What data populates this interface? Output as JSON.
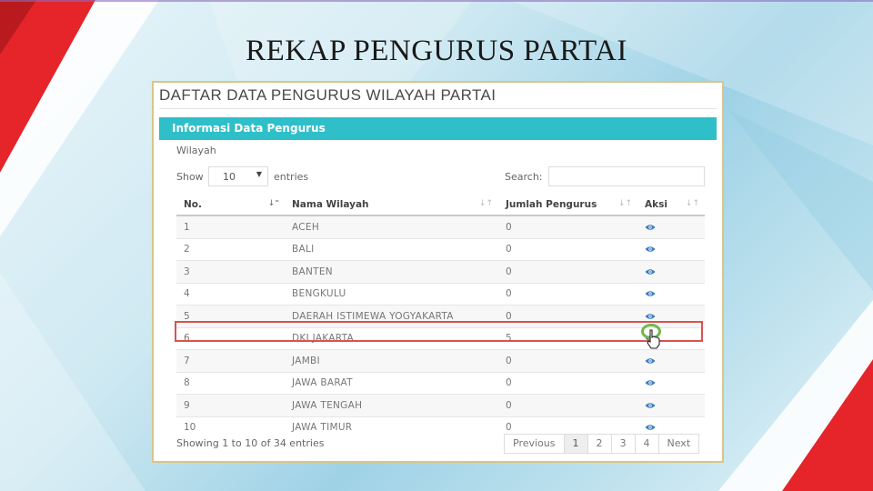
{
  "slide": {
    "title": "REKAP PENGURUS PARTAI"
  },
  "panel": {
    "title": "DAFTAR DATA PENGURUS WILAYAH PARTAI",
    "section_header": "Informasi Data Pengurus",
    "wilayah_label": "Wilayah",
    "show_label": "Show",
    "entries_value": "10",
    "entries_label": "entries",
    "search_label": "Search:",
    "search_value": ""
  },
  "table": {
    "columns": [
      "No.",
      "Nama Wilayah",
      "Jumlah Pengurus",
      "Aksi"
    ],
    "rows": [
      {
        "no": "1",
        "wilayah": "ACEH",
        "jumlah": "0"
      },
      {
        "no": "2",
        "wilayah": "BALI",
        "jumlah": "0"
      },
      {
        "no": "3",
        "wilayah": "BANTEN",
        "jumlah": "0"
      },
      {
        "no": "4",
        "wilayah": "BENGKULU",
        "jumlah": "0"
      },
      {
        "no": "5",
        "wilayah": "DAERAH ISTIMEWA YOGYAKARTA",
        "jumlah": "0"
      },
      {
        "no": "6",
        "wilayah": "DKI JAKARTA",
        "jumlah": "5"
      },
      {
        "no": "7",
        "wilayah": "JAMBI",
        "jumlah": "0"
      },
      {
        "no": "8",
        "wilayah": "JAWA BARAT",
        "jumlah": "0"
      },
      {
        "no": "9",
        "wilayah": "JAWA TENGAH",
        "jumlah": "0"
      },
      {
        "no": "10",
        "wilayah": "JAWA TIMUR",
        "jumlah": "0"
      }
    ],
    "action_icon": "eye-icon"
  },
  "footer": {
    "info": "Showing 1 to 10 of 34 entries",
    "pagination": [
      "Previous",
      "1",
      "2",
      "3",
      "4",
      "Next"
    ],
    "active_page": "1"
  },
  "colors": {
    "header_teal": "#2fbfc9",
    "link_blue": "#3b7bbf",
    "highlight_red": "#d9534f",
    "ring_green": "#6fb84a",
    "accent_red": "#e8272a"
  }
}
